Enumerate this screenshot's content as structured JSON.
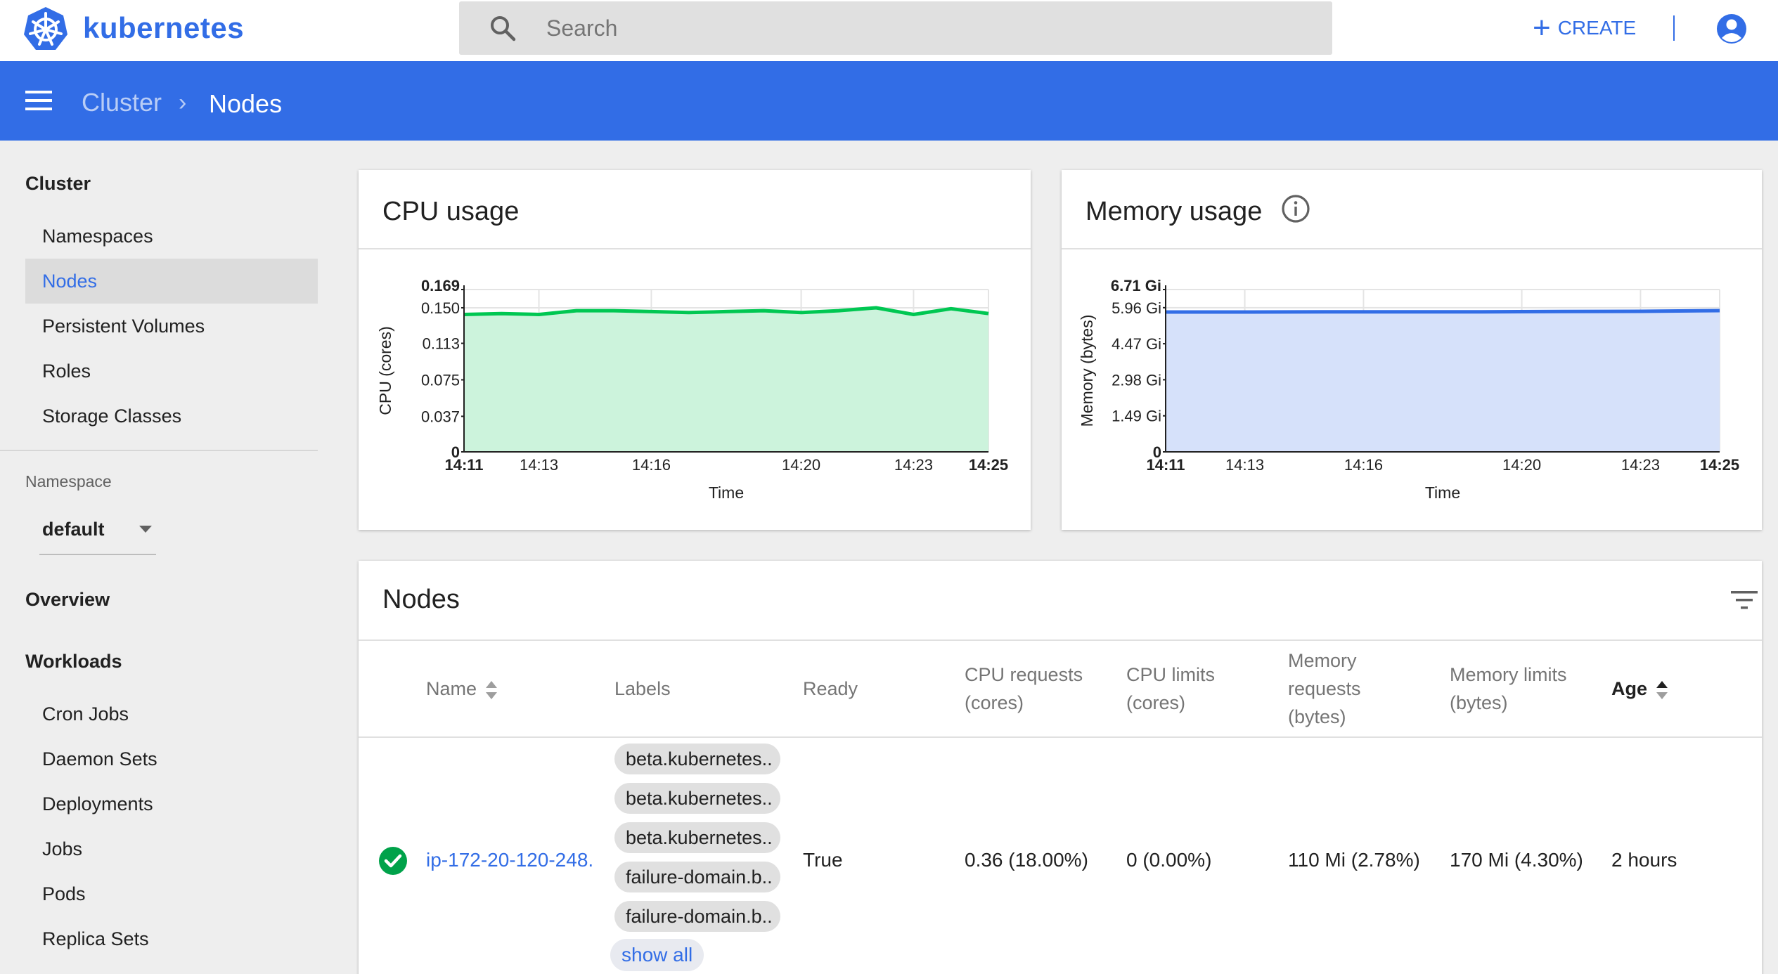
{
  "topbar": {
    "brand": "kubernetes",
    "search_placeholder": "Search",
    "create_label": "CREATE"
  },
  "header": {
    "breadcrumb": [
      "Cluster",
      "Nodes"
    ]
  },
  "sidebar": {
    "cluster_heading": "Cluster",
    "cluster_items": [
      {
        "label": "Namespaces",
        "active": false
      },
      {
        "label": "Nodes",
        "active": true
      },
      {
        "label": "Persistent Volumes",
        "active": false
      },
      {
        "label": "Roles",
        "active": false
      },
      {
        "label": "Storage Classes",
        "active": false
      }
    ],
    "namespace_label": "Namespace",
    "namespace_value": "default",
    "overview_heading": "Overview",
    "workloads_heading": "Workloads",
    "workload_items": [
      "Cron Jobs",
      "Daemon Sets",
      "Deployments",
      "Jobs",
      "Pods",
      "Replica Sets"
    ]
  },
  "cpu_card": {
    "title": "CPU usage"
  },
  "memory_card": {
    "title": "Memory usage"
  },
  "chart_data": [
    {
      "type": "area",
      "title": "CPU usage",
      "xlabel": "Time",
      "ylabel": "CPU (cores)",
      "x_tick_labels": [
        "14:11",
        "14:13",
        "14:16",
        "14:20",
        "14:23",
        "14:25"
      ],
      "x_tick_bold": [
        true,
        false,
        false,
        false,
        false,
        true
      ],
      "x_range_minutes": [
        0,
        14
      ],
      "x_tick_minutes": [
        0,
        2,
        5,
        9,
        12,
        14
      ],
      "y_ticks": [
        0,
        0.037,
        0.075,
        0.113,
        0.15,
        0.169
      ],
      "y_tick_labels": [
        "0",
        "0.037",
        "0.075",
        "0.113",
        "0.150",
        "0.169"
      ],
      "y_tick_bold": [
        true,
        false,
        false,
        false,
        false,
        true
      ],
      "ylim": [
        0,
        0.169
      ],
      "grid": true,
      "color": "#00c752",
      "fill": "#ccf3dc",
      "series": [
        {
          "x_minutes": [
            0,
            1,
            2,
            3,
            4,
            5,
            6,
            7,
            8,
            9,
            10,
            11,
            12,
            13,
            14
          ],
          "values": [
            0.143,
            0.144,
            0.143,
            0.147,
            0.147,
            0.146,
            0.145,
            0.146,
            0.147,
            0.145,
            0.147,
            0.15,
            0.143,
            0.149,
            0.144
          ]
        }
      ]
    },
    {
      "type": "area",
      "title": "Memory usage",
      "xlabel": "Time",
      "ylabel": "Memory (bytes)",
      "x_tick_labels": [
        "14:11",
        "14:13",
        "14:16",
        "14:20",
        "14:23",
        "14:25"
      ],
      "x_tick_bold": [
        true,
        false,
        false,
        false,
        false,
        true
      ],
      "x_range_minutes": [
        0,
        14
      ],
      "x_tick_minutes": [
        0,
        2,
        5,
        9,
        12,
        14
      ],
      "y_ticks": [
        0,
        1.49,
        2.98,
        4.47,
        5.96,
        6.71
      ],
      "y_tick_labels": [
        "0",
        "1.49 Gi",
        "2.98 Gi",
        "4.47 Gi",
        "5.96 Gi",
        "6.71 Gi"
      ],
      "y_tick_bold": [
        true,
        false,
        false,
        false,
        false,
        true
      ],
      "ylim": [
        0,
        6.71
      ],
      "grid": true,
      "color": "#326de6",
      "fill": "#d6e1fa",
      "series": [
        {
          "x_minutes": [
            0,
            2,
            4,
            6,
            8,
            10,
            12,
            14
          ],
          "values": [
            5.78,
            5.78,
            5.79,
            5.79,
            5.79,
            5.8,
            5.81,
            5.84
          ]
        }
      ]
    }
  ],
  "nodes_card": {
    "title": "Nodes",
    "columns": {
      "name": "Name",
      "labels": "Labels",
      "ready": "Ready",
      "cpu_requests": [
        "CPU requests",
        "(cores)"
      ],
      "cpu_limits": [
        "CPU limits",
        "(cores)"
      ],
      "mem_requests": [
        "Memory",
        "requests",
        "(bytes)"
      ],
      "mem_limits": [
        "Memory limits",
        "(bytes)"
      ],
      "age": "Age"
    },
    "rows": [
      {
        "name": "ip-172-20-120-248.",
        "labels": [
          "beta.kubernetes..",
          "beta.kubernetes..",
          "beta.kubernetes..",
          "failure-domain.b..",
          "failure-domain.b.."
        ],
        "show_all": "show all",
        "ready": "True",
        "cpu_requests": "0.36 (18.00%)",
        "cpu_limits": "0 (0.00%)",
        "mem_requests": "110 Mi (2.78%)",
        "mem_limits": "170 Mi (4.30%)",
        "age": "2 hours"
      }
    ]
  }
}
